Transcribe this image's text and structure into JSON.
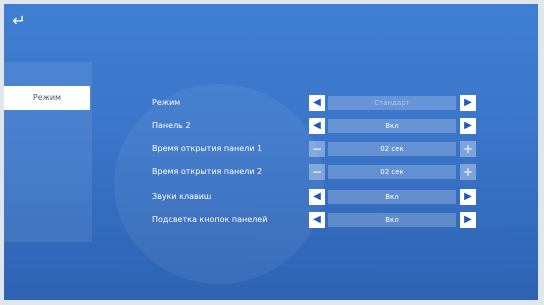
{
  "icons": {
    "back": "back-arrow-icon",
    "left": "triangle-left-icon",
    "right": "triangle-right-icon",
    "minus": "minus-icon",
    "plus": "plus-icon"
  },
  "sidebar": {
    "items": [
      {
        "label": "Режим"
      }
    ]
  },
  "settings": [
    {
      "label": "Режим",
      "value": "Стандарт",
      "control": "arrows"
    },
    {
      "label": "Панель 2",
      "value": "Вкл",
      "control": "arrows"
    },
    {
      "label": "Время открытия панели 1",
      "value": "02  сек",
      "control": "stepper"
    },
    {
      "label": "Время открытия панели 2",
      "value": "02  сек",
      "control": "stepper"
    },
    {
      "label": "Звуки клавиш",
      "value": "Вкл",
      "control": "arrows"
    },
    {
      "label": "Подсветка кнопок панелей",
      "value": "Вкл",
      "control": "arrows"
    }
  ],
  "colors": {
    "background": "#3a75c9",
    "highlight": "#ffffff",
    "selected_text": "#4a5a73"
  }
}
